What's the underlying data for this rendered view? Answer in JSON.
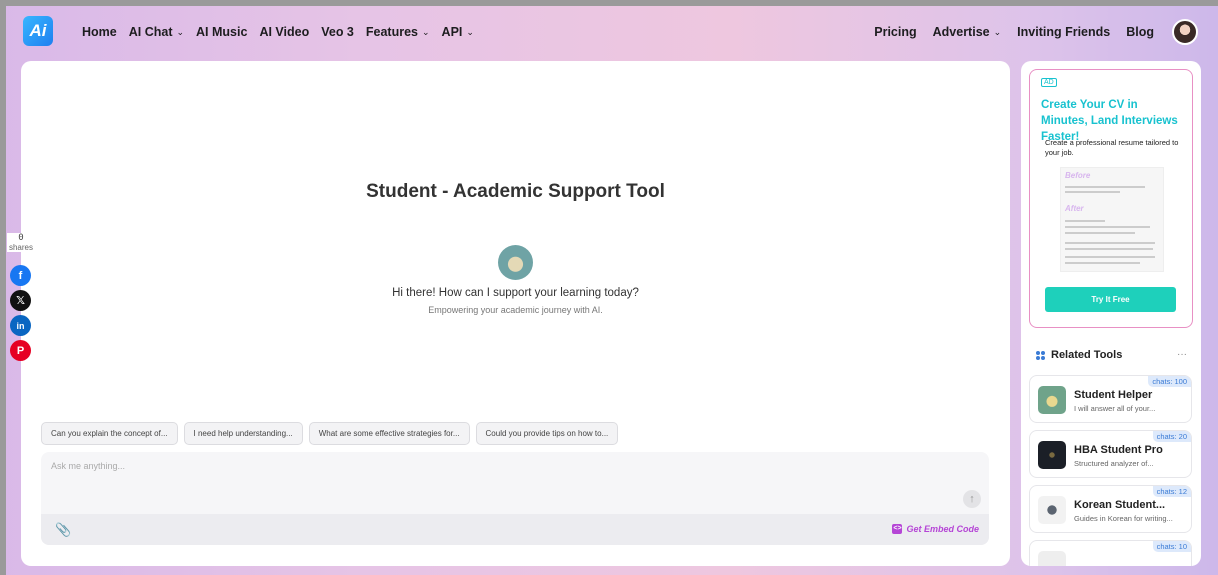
{
  "nav": {
    "logo_text": "Ai",
    "left_items": [
      {
        "label": "Home",
        "dropdown": false
      },
      {
        "label": "AI Chat",
        "dropdown": true
      },
      {
        "label": "AI Music",
        "dropdown": false
      },
      {
        "label": "AI Video",
        "dropdown": false
      },
      {
        "label": "Veo 3",
        "dropdown": false
      },
      {
        "label": "Features",
        "dropdown": true
      },
      {
        "label": "API",
        "dropdown": true
      }
    ],
    "right_items": [
      {
        "label": "Pricing",
        "dropdown": false
      },
      {
        "label": "Advertise",
        "dropdown": true
      },
      {
        "label": "Inviting Friends",
        "dropdown": false
      },
      {
        "label": "Blog",
        "dropdown": false
      }
    ]
  },
  "chat": {
    "title": "Student - Academic Support Tool",
    "greeting": "Hi there! How can I support your learning today?",
    "subtitle": "Empowering your academic journey with AI.",
    "suggestions": [
      "Can you explain the concept of...",
      "I need help understanding...",
      "What are some effective strategies for...",
      "Could you provide tips on how to..."
    ],
    "input_placeholder": "Ask me anything...",
    "embed_label": "Get Embed Code"
  },
  "shares": {
    "count": "0",
    "label": "shares"
  },
  "ad": {
    "tag": "AD",
    "headline": "Create Your CV in Minutes, Land Interviews Faster!",
    "subtext": "Create a professional resume tailored to your job.",
    "before_label": "Before",
    "after_label": "After",
    "button": "Try It Free"
  },
  "related": {
    "heading": "Related Tools",
    "more": "···",
    "tools": [
      {
        "name": "Student Helper",
        "desc": "I will answer all of your...",
        "chats": "chats: 100"
      },
      {
        "name": "HBA Student Pro",
        "desc": "Structured analyzer of...",
        "chats": "chats: 20"
      },
      {
        "name": "Korean Student...",
        "desc": "Guides in Korean for writing...",
        "chats": "chats: 12"
      },
      {
        "name": "",
        "desc": "",
        "chats": "chats: 10"
      }
    ]
  },
  "colors": {
    "accent_teal": "#18c2cf",
    "button_teal": "#1ed0bb",
    "embed_purple": "#b545d6",
    "badge_blue": "#3a7bd5"
  }
}
